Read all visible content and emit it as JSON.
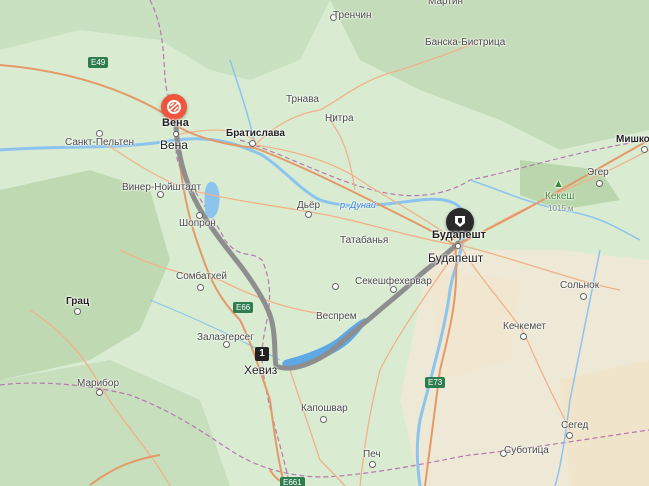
{
  "map": {
    "cities": [
      {
        "name": "Мартин"
      },
      {
        "name": "Тренчин"
      },
      {
        "name": "Банска-Бистрица"
      },
      {
        "name": "Трнава"
      },
      {
        "name": "Нитра"
      },
      {
        "name": "Братислава"
      },
      {
        "name": "Санкт-Пельтен"
      },
      {
        "name": "Винер-Нойштадт"
      },
      {
        "name": "Шопрон"
      },
      {
        "name": "Дьёр"
      },
      {
        "name": "Татабанья"
      },
      {
        "name": "Сомбатхей"
      },
      {
        "name": "Секешфехервар"
      },
      {
        "name": "Веспрем"
      },
      {
        "name": "Грац"
      },
      {
        "name": "Залаэгерсег"
      },
      {
        "name": "Марибор"
      },
      {
        "name": "Капошвар"
      },
      {
        "name": "Печ"
      },
      {
        "name": "Мишкольц"
      },
      {
        "name": "Эгер"
      },
      {
        "name": "Сольнок"
      },
      {
        "name": "Кечкемет"
      },
      {
        "name": "Сегед"
      },
      {
        "name": "Суботица"
      }
    ],
    "start_city": "Вена",
    "end_city": "Будапешт",
    "waypoint_label": "Хевиз",
    "waypoint_number": "1",
    "river": "р. Дунай",
    "peak": {
      "name": "Кекеш",
      "elevation": "1015 м"
    },
    "road_shields": [
      "E49",
      "E66",
      "E73",
      "E661"
    ],
    "road_shield_color": "#2f7d4f",
    "route_color": "#8e8e8e",
    "start_pin_color": "#f0553d",
    "end_pin_color": "#2a2a2a"
  }
}
